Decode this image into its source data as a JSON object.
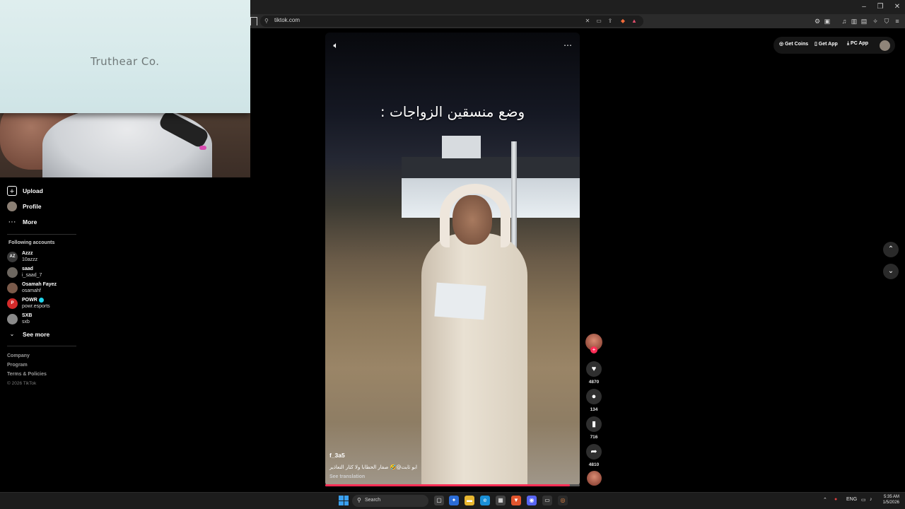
{
  "browser": {
    "url": "tiktok.com",
    "window_controls": {
      "minimize": "–",
      "restore": "❐",
      "close": "✕"
    }
  },
  "webcam": {
    "card_text": "Truthear Co."
  },
  "sidebar": {
    "items": [
      {
        "label": "Upload",
        "icon": "upload-icon",
        "glyph": "+"
      },
      {
        "label": "Profile",
        "icon": "profile-avatar",
        "glyph": ""
      },
      {
        "label": "More",
        "icon": "more-icon",
        "glyph": "···"
      }
    ],
    "following_heading": "Following accounts",
    "accounts": [
      {
        "name": "Azzz",
        "handle": "10azzz",
        "badge": "AZ",
        "color": "#3a3a3a",
        "verified": false
      },
      {
        "name": "saad",
        "handle": "i_saad_7",
        "badge": "",
        "color": "#6d6760",
        "verified": false
      },
      {
        "name": "Osamah Fayez",
        "handle": "osamahf",
        "badge": "",
        "color": "#7a5a4a",
        "verified": false
      },
      {
        "name": "POWR",
        "handle": "powr.esports",
        "badge": "P",
        "color": "#d42a2a",
        "verified": true
      },
      {
        "name": "SXB",
        "handle": "sxb",
        "badge": "",
        "color": "#8a8a8a",
        "verified": false
      }
    ],
    "see_more": "See more",
    "footer": [
      "Company",
      "Program",
      "Terms & Policies"
    ],
    "copyright": "© 2026 TikTok"
  },
  "video": {
    "overlay_text": "وضع منسقين الزواجات :",
    "author": "f_3a5",
    "caption": "ابو ثابت@🤣 صفار الحطابا ولا كثار التعاذير",
    "see_translation": "See translation",
    "progress": 0.96,
    "sound_icon": "volume-icon",
    "more_icon": "more-options-icon"
  },
  "actions": {
    "likes": "4870",
    "comments": "134",
    "saves": "716",
    "shares": "4810"
  },
  "top_buttons": {
    "coins": "Get Coins",
    "app": "Get App",
    "pc": "PC App"
  },
  "taskbar": {
    "search_placeholder": "Search",
    "lang": "ENG",
    "time": "5:35 AM",
    "date": "1/5/2026"
  }
}
